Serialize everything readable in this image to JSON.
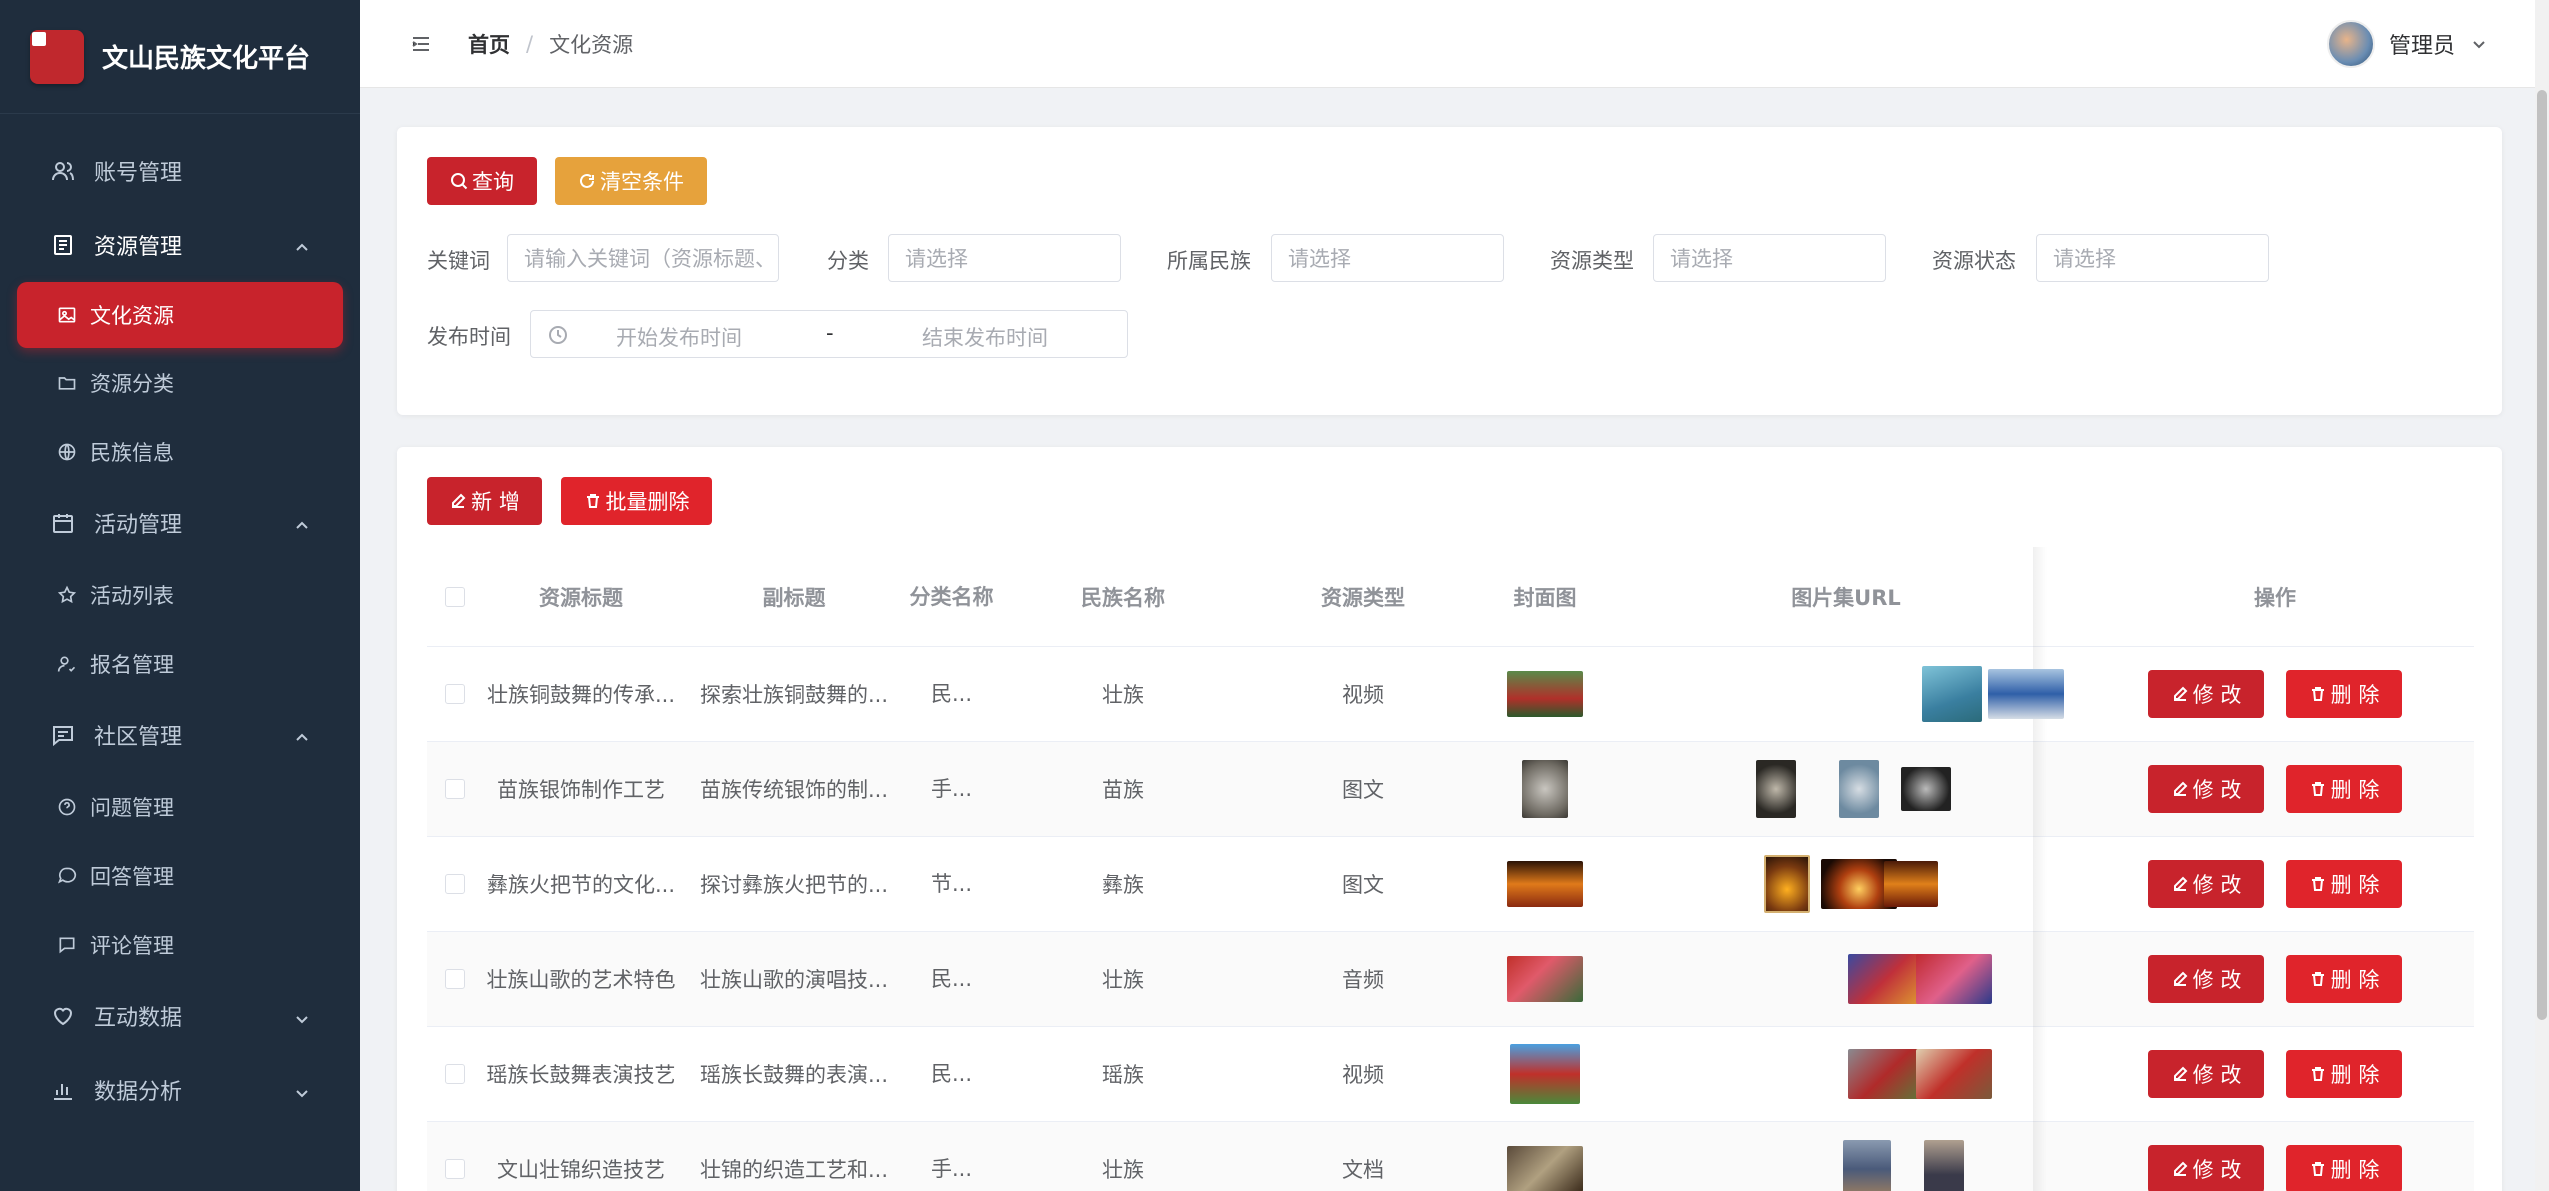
{
  "app": {
    "title": "文山民族文化平台"
  },
  "sidebar": {
    "items": [
      {
        "label": "账号管理",
        "icon": "user-icon"
      },
      {
        "label": "资源管理",
        "icon": "document-icon",
        "children": [
          {
            "label": "文化资源",
            "icon": "image-icon",
            "active": true
          },
          {
            "label": "资源分类",
            "icon": "folder-icon"
          },
          {
            "label": "民族信息",
            "icon": "globe-icon"
          }
        ]
      },
      {
        "label": "活动管理",
        "icon": "calendar-icon",
        "children": [
          {
            "label": "活动列表",
            "icon": "star-icon"
          },
          {
            "label": "报名管理",
            "icon": "user-check-icon"
          }
        ]
      },
      {
        "label": "社区管理",
        "icon": "chat-icon",
        "children": [
          {
            "label": "问题管理",
            "icon": "question-icon"
          },
          {
            "label": "回答管理",
            "icon": "comment-icon"
          },
          {
            "label": "评论管理",
            "icon": "message-icon"
          }
        ]
      },
      {
        "label": "互动数据",
        "icon": "heart-icon"
      },
      {
        "label": "数据分析",
        "icon": "bar-chart-icon"
      }
    ]
  },
  "header": {
    "breadcrumb": {
      "home": "首页",
      "separator": "/",
      "current": "文化资源"
    },
    "user": {
      "name": "管理员"
    }
  },
  "search": {
    "query_label": "查询",
    "reset_label": "清空条件",
    "fields": {
      "keyword": {
        "label": "关键词",
        "placeholder": "请输入关键词（资源标题、"
      },
      "category": {
        "label": "分类",
        "placeholder": "请选择"
      },
      "ethnic": {
        "label": "所属民族",
        "placeholder": "请选择"
      },
      "type": {
        "label": "资源类型",
        "placeholder": "请选择"
      },
      "status": {
        "label": "资源状态",
        "placeholder": "请选择"
      },
      "publish": {
        "label": "发布时间",
        "start_placeholder": "开始发布时间",
        "separator": "-",
        "end_placeholder": "结束发布时间"
      }
    }
  },
  "toolbar": {
    "add_label": "新 增",
    "batch_delete_label": "批量删除"
  },
  "table": {
    "headers": {
      "title": "资源标题",
      "subtitle": "副标题",
      "category": "分类名称",
      "ethnic": "民族名称",
      "type": "资源类型",
      "cover": "封面图",
      "gallery": "图片集URL",
      "ops": "操作"
    },
    "edit_label": "修 改",
    "delete_label": "删 除",
    "rows": [
      {
        "title": "壮族铜鼓舞的传承...",
        "subtitle": "探索壮族铜鼓舞的...",
        "category": "民...",
        "ethnic": "壮族",
        "type": "视频"
      },
      {
        "title": "苗族银饰制作工艺",
        "subtitle": "苗族传统银饰的制...",
        "category": "手...",
        "ethnic": "苗族",
        "type": "图文"
      },
      {
        "title": "彝族火把节的文化...",
        "subtitle": "探讨彝族火把节的...",
        "category": "节...",
        "ethnic": "彝族",
        "type": "图文"
      },
      {
        "title": "壮族山歌的艺术特色",
        "subtitle": "壮族山歌的演唱技...",
        "category": "民...",
        "ethnic": "壮族",
        "type": "音频"
      },
      {
        "title": "瑶族长鼓舞表演技艺",
        "subtitle": "瑶族长鼓舞的表演...",
        "category": "民...",
        "ethnic": "瑶族",
        "type": "视频"
      },
      {
        "title": "文山壮锦织造技艺",
        "subtitle": "壮锦的织造工艺和...",
        "category": "手...",
        "ethnic": "壮族",
        "type": "文档"
      }
    ]
  },
  "colors": {
    "primary": "#c8232c",
    "warning": "#e6a23c",
    "sidebar": "#1f2d3d"
  }
}
